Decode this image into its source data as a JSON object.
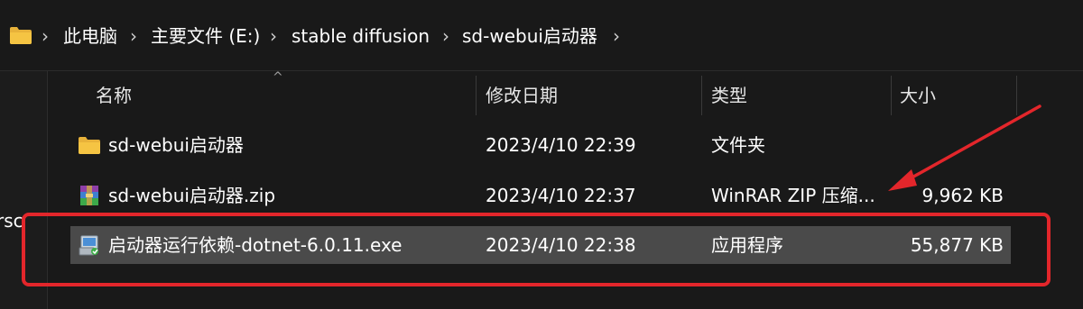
{
  "breadcrumb": {
    "items": [
      "此电脑",
      "主要文件 (E:)",
      "stable diffusion",
      "sd-webui启动器"
    ],
    "separator": "›"
  },
  "navpane": {
    "partial_text": "rsc"
  },
  "columns": {
    "name": "名称",
    "date": "修改日期",
    "type": "类型",
    "size": "大小"
  },
  "files": [
    {
      "name": "sd-webui启动器",
      "date": "2023/4/10 22:39",
      "type": "文件夹",
      "size": "",
      "icon": "folder-icon"
    },
    {
      "name": "sd-webui启动器.zip",
      "date": "2023/4/10 22:37",
      "type": "WinRAR ZIP 压缩...",
      "size": "9,962 KB",
      "icon": "winrar-archive-icon"
    },
    {
      "name": "启动器运行依赖-dotnet-6.0.11.exe",
      "date": "2023/4/10 22:38",
      "type": "应用程序",
      "size": "55,877 KB",
      "icon": "installer-icon",
      "selected": true
    }
  ],
  "colors": {
    "background": "#191919",
    "selected_row": "#4a4a4a",
    "annotation_red": "#e3262b",
    "folder_yellow": "#f5c443"
  }
}
